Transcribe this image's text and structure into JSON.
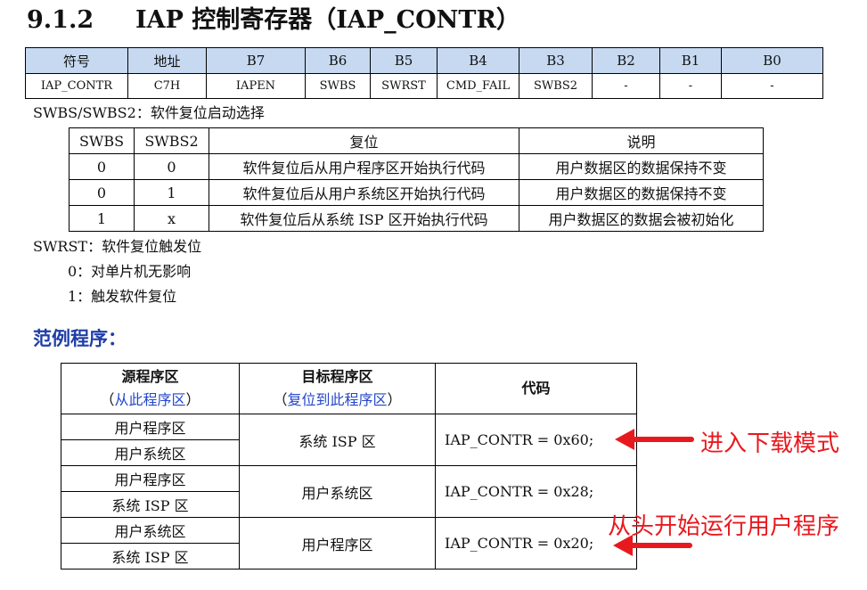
{
  "section": {
    "number": "9.1.2",
    "title": "IAP 控制寄存器（IAP_CONTR）"
  },
  "register_table": {
    "headers": [
      "符号",
      "地址",
      "B7",
      "B6",
      "B5",
      "B4",
      "B3",
      "B2",
      "B1",
      "B0"
    ],
    "row": [
      "IAP_CONTR",
      "C7H",
      "IAPEN",
      "SWBS",
      "SWRST",
      "CMD_FAIL",
      "SWBS2",
      "-",
      "-",
      "-"
    ]
  },
  "swbs_desc": "SWBS/SWBS2：软件复位启动选择",
  "swbs_table": {
    "headers": [
      "SWBS",
      "SWBS2",
      "复位",
      "说明"
    ],
    "rows": [
      [
        "0",
        "0",
        "软件复位后从用户程序区开始执行代码",
        "用户数据区的数据保持不变"
      ],
      [
        "0",
        "1",
        "软件复位后从用户系统区开始执行代码",
        "用户数据区的数据保持不变"
      ],
      [
        "1",
        "x",
        "软件复位后从系统 ISP 区开始执行代码",
        "用户数据区的数据会被初始化"
      ]
    ]
  },
  "swrst": {
    "title": "SWRST：软件复位触发位",
    "items": [
      "0：对单片机无影响",
      "1：触发软件复位"
    ]
  },
  "example": {
    "title": "范例程序：",
    "headers": {
      "source": "源程序区",
      "source_sub": "从此程序区",
      "target": "目标程序区",
      "target_sub": "复位到此程序区",
      "code": "代码"
    },
    "rows": [
      {
        "sources": [
          "用户程序区",
          "用户系统区"
        ],
        "target": "系统 ISP 区",
        "code": "IAP_CONTR = 0x60;"
      },
      {
        "sources": [
          "用户程序区",
          "系统 ISP 区"
        ],
        "target": "用户系统区",
        "code": "IAP_CONTR = 0x28;"
      },
      {
        "sources": [
          "用户系统区",
          "系统 ISP 区"
        ],
        "target": "用户程序区",
        "code": "IAP_CONTR = 0x20;"
      }
    ]
  },
  "annotations": {
    "enter_download": "进入下载模式",
    "run_user": "从头开始运行用户程序",
    "color": "#e8191e"
  }
}
